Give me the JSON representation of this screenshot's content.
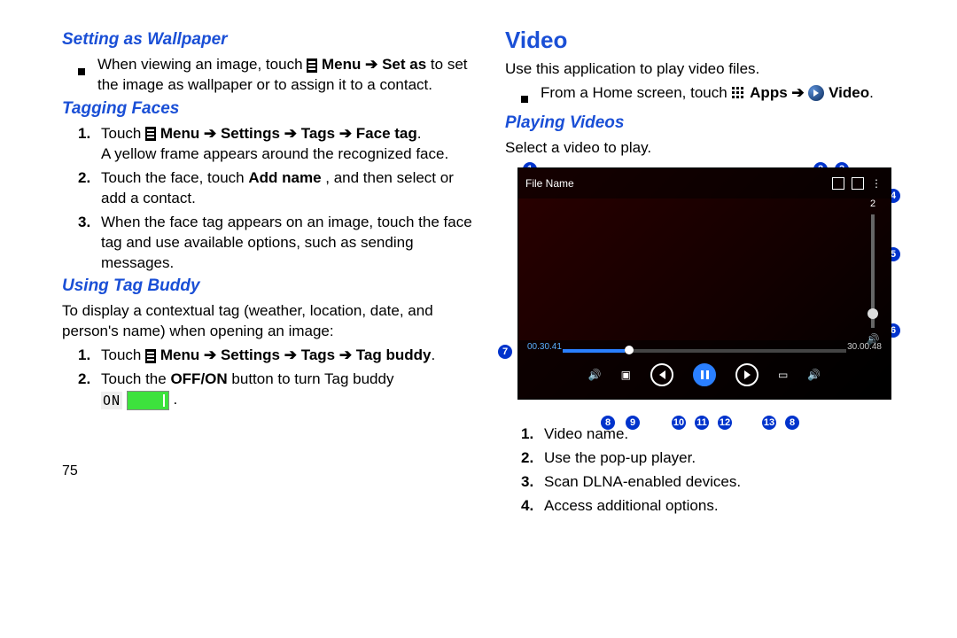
{
  "left": {
    "h_wallpaper": "Setting as Wallpaper",
    "wallpaper_text_a": "When viewing an image, touch ",
    "wallpaper_menu": "Menu",
    "wallpaper_setas": "Set as",
    "wallpaper_text_b": " to set the image as wallpaper or to assign it to a contact.",
    "h_tagging": "Tagging Faces",
    "tag1_a": "Touch ",
    "tag1_menu": "Menu",
    "tag1_path": "Settings ➔ Tags ➔ Face tag",
    "tag1_b": "A yellow frame appears around the recognized face.",
    "tag2_a": "Touch the face, touch ",
    "tag2_add": "Add name",
    "tag2_b": ", and then select or add a contact.",
    "tag3": "When the face tag appears on an image, touch the face tag and use available options, such as sending messages.",
    "h_buddy": "Using Tag Buddy",
    "buddy_intro": "To display a contextual tag (weather, location, date, and person's name) when opening an image:",
    "buddy1_a": "Touch ",
    "buddy1_menu": "Menu",
    "buddy1_path": "Settings ➔ Tags ➔ Tag buddy",
    "buddy2_a": "Touch the ",
    "buddy2_offon": "OFF/ON",
    "buddy2_b": " button to turn Tag buddy",
    "buddy2_on": "ON",
    "page_num": "75"
  },
  "right": {
    "h_video": "Video",
    "video_intro": "Use this application to play video files.",
    "video_nav_a": "From a Home screen, touch ",
    "video_nav_apps": "Apps",
    "video_nav_video": "Video",
    "h_playing": "Playing Videos",
    "playing_intro": "Select a video to play.",
    "player": {
      "filename": "File Name",
      "time_current": "00.30.41",
      "time_total": "30.00.48",
      "vol_label_top": "2"
    },
    "list": {
      "i1": "Video name.",
      "i2": "Use the pop-up player.",
      "i3": "Scan DLNA-enabled devices.",
      "i4": "Access additional options."
    }
  },
  "arrow": "➔"
}
